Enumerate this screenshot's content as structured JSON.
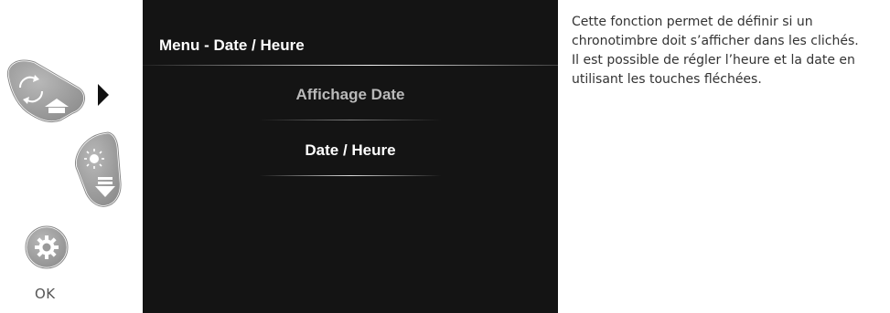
{
  "controls": {
    "ok_label": "OK",
    "icons": [
      "rotate-up-button-icon",
      "brightness-down-button-icon",
      "settings-ok-button-icon",
      "arrow-right-icon"
    ]
  },
  "screen": {
    "title": "Menu - Date / Heure",
    "items": [
      {
        "label": "Affichage Date",
        "state": "inactive"
      },
      {
        "label": "Date / Heure",
        "state": "selected"
      }
    ]
  },
  "description": {
    "paragraph_1": "Cette fonction permet de définir si un chronotimbre doit s’afficher dans les clichés.",
    "paragraph_2": "Il est possible de régler l’heure et la date en utilisant les touches fléchées."
  },
  "colors": {
    "screen_background": "#141414",
    "button_gray": "#9a9a9a",
    "text_dark": "#333333"
  }
}
